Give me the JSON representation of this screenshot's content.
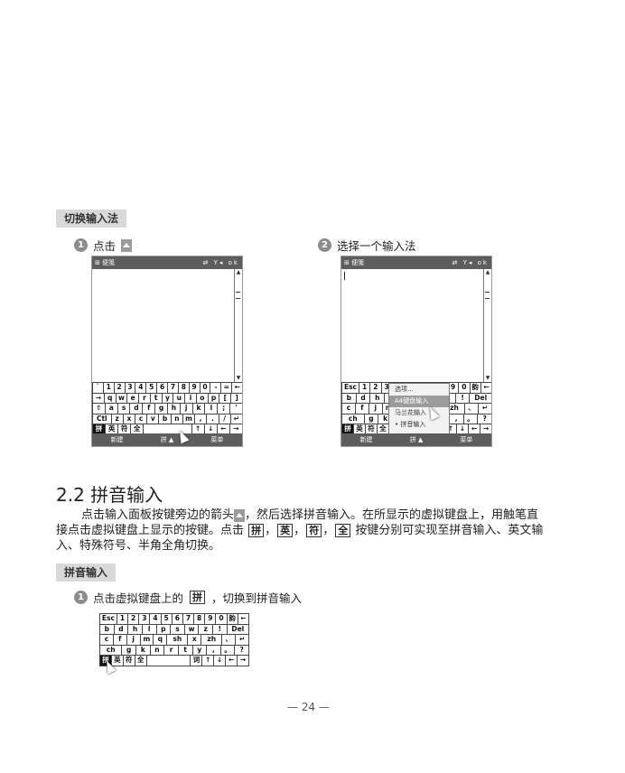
{
  "section_banner_1": "切换输入法",
  "step1": {
    "num": "1",
    "text": "点击"
  },
  "step2": {
    "num": "2",
    "text": "选择一个输入法"
  },
  "device": {
    "title": "便笺",
    "status_icons": "⇄ Y◂ ok",
    "menu_left": "新建",
    "menu_right": "菜单",
    "menu_mid": "拼 ▲"
  },
  "keyboard_en": [
    [
      "`",
      "1",
      "2",
      "3",
      "4",
      "5",
      "6",
      "7",
      "8",
      "9",
      "0",
      "-",
      "=",
      "←"
    ],
    [
      "→",
      "q",
      "w",
      "e",
      "r",
      "t",
      "y",
      "u",
      "i",
      "o",
      "p",
      "[",
      "]"
    ],
    [
      "⇧",
      "a",
      "s",
      "d",
      "f",
      "g",
      "h",
      "j",
      "k",
      "l",
      ";",
      "'"
    ],
    [
      "Ctl",
      "z",
      "x",
      "c",
      "v",
      "b",
      "n",
      "m",
      ",",
      ".",
      "/",
      "↵"
    ],
    [
      "拼",
      "英",
      "符",
      "全",
      "",
      "↑",
      "↓",
      "←",
      "→"
    ]
  ],
  "keyboard_py": [
    [
      "Esc",
      "1",
      "2",
      "3",
      "4",
      "5",
      "6",
      "7",
      "8",
      "9",
      "0",
      "韵",
      "←"
    ],
    [
      "b",
      "d",
      "h",
      "l",
      "p",
      "s",
      "w",
      "z",
      "!",
      "Del"
    ],
    [
      "c",
      "f",
      "j",
      "m",
      "q",
      "sh",
      "x",
      "zh",
      "、",
      "↵"
    ],
    [
      "ch",
      "g",
      "k",
      "n",
      "r",
      "t",
      "y",
      ",",
      "。",
      "?"
    ],
    [
      "拼",
      "英",
      "符",
      "全",
      "",
      "词",
      "↑",
      "↓",
      "←",
      "→"
    ]
  ],
  "popup": [
    "选项...",
    "A4键盘输入",
    "马兰花输入",
    "• 拼音输入"
  ],
  "heading": "2.2  拼音输入",
  "paragraph": {
    "line1_a": "点击输入面板按键旁边的箭头",
    "line1_b": "，然后选择拼音输入。在所显示的虚拟键盘上，用触笔直",
    "line2_a": "接点击虚拟键盘上显示的按键。点击",
    "key_pin": "拼",
    "key_ying": "英",
    "key_fu": "符",
    "key_quan": "全",
    "line2_b": "按键分别可实现至拼音输入、英文输",
    "line3": "入、特殊符号、半角全角切换。"
  },
  "section_banner_2": "拼音输入",
  "step3": {
    "num": "1",
    "text_a": "点击虚拟键盘上的",
    "key": "拼",
    "text_b": "，切换到拼音输入"
  },
  "page_number": "— 24 —"
}
